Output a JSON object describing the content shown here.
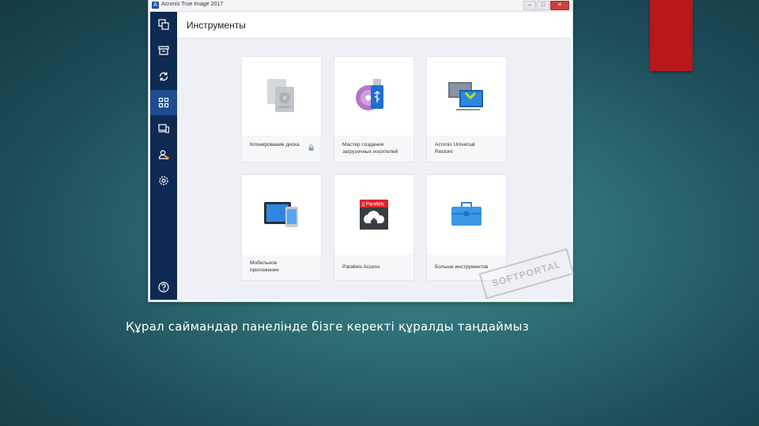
{
  "window": {
    "title": "Acronis True Image 2017",
    "app_icon": "acronis-logo-icon",
    "buttons": {
      "minimize": "–",
      "maximize": "□",
      "close": "✕"
    }
  },
  "sidebar": {
    "items": [
      {
        "icon": "backup-copy-icon",
        "active": false
      },
      {
        "icon": "archive-icon",
        "active": false
      },
      {
        "icon": "sync-icon",
        "active": false
      },
      {
        "icon": "tools-grid-icon",
        "active": true
      },
      {
        "icon": "devices-icon",
        "active": false
      },
      {
        "icon": "account-icon",
        "active": false
      },
      {
        "icon": "settings-icon",
        "active": false
      },
      {
        "icon": "help-icon",
        "active": false
      }
    ]
  },
  "main": {
    "title": "Инструменты",
    "tiles": [
      {
        "label": "Клонирование диска",
        "icon": "disk-clone-icon",
        "locked": true
      },
      {
        "label": "Мастер создания загрузочных носителей",
        "icon": "bootable-media-icon",
        "locked": false
      },
      {
        "label": "Acronis Universal Restore",
        "icon": "universal-restore-icon",
        "locked": false
      },
      {
        "label": "Мобильное приложение",
        "icon": "mobile-app-icon",
        "locked": false
      },
      {
        "label": "Parallels Access",
        "icon": "parallels-access-icon",
        "locked": false
      },
      {
        "label": "Больше инструментов",
        "icon": "more-tools-icon",
        "locked": false
      }
    ]
  },
  "watermark": "SOFTPORTAL",
  "caption": "Құрал саймандар панелінде бізге керекті құралды таңдаймыз",
  "colors": {
    "sidebar": "#0e2a52",
    "sidebar_active": "#1f4c8f",
    "accent_red": "#b8171b",
    "background": "#2d6c74"
  }
}
